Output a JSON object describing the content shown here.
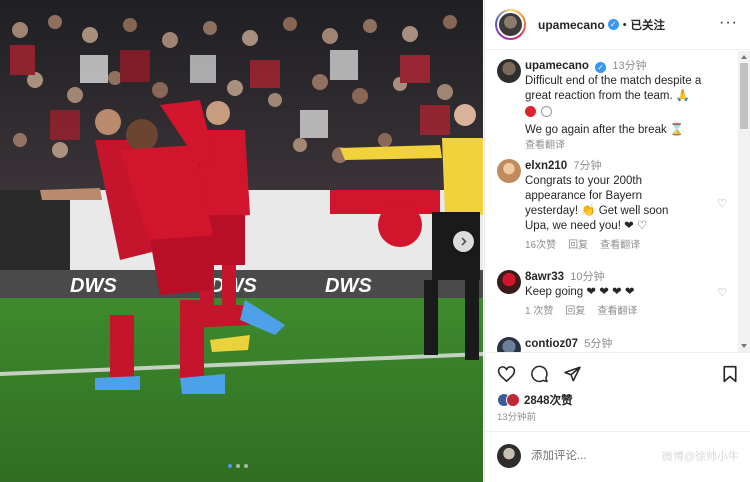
{
  "post": {
    "username": "upamecano",
    "verified_mark": "✓",
    "separator": "•",
    "follow_label": "已关注",
    "more_label": "···"
  },
  "photo": {
    "banner_texts": [
      "DWS",
      "DWS",
      "DWS"
    ],
    "carousel_count": 3,
    "carousel_active": 1
  },
  "comments": [
    {
      "username": "upamecano",
      "time": "13分钟",
      "text_lines": [
        "Difficult end of the match despite a",
        "great reaction from the team. 🙏",
        "We go again after the break ⌛"
      ],
      "see_translation": "查看翻译"
    },
    {
      "username": "elxn210",
      "time": "7分钟",
      "text_lines": [
        "Congrats to your 200th",
        "appearance for Bayern",
        "yesterday! 👏 Get well soon",
        "Upa, we need you! ❤ ♡"
      ],
      "likes": "16次赞",
      "reply": "回复",
      "see_translation": "查看翻译"
    },
    {
      "username": "8awr33",
      "time": "10分钟",
      "text": "Keep going ❤ ❤ ❤ ❤",
      "likes": "1 次赞",
      "reply": "回复",
      "see_translation": "查看翻译"
    },
    {
      "username": "contioz07",
      "time": "5分钟"
    }
  ],
  "footer": {
    "likes": "2848次赞",
    "time_ago": "13分钟前",
    "add_comment_placeholder": "添加评论...",
    "watermark": "微博@徐帅小牛"
  },
  "colors": {
    "verified": "#3897f0",
    "heart_red": "#ed1c3a",
    "muted": "#8e8e8e",
    "bayern_red": "#d0152d"
  }
}
